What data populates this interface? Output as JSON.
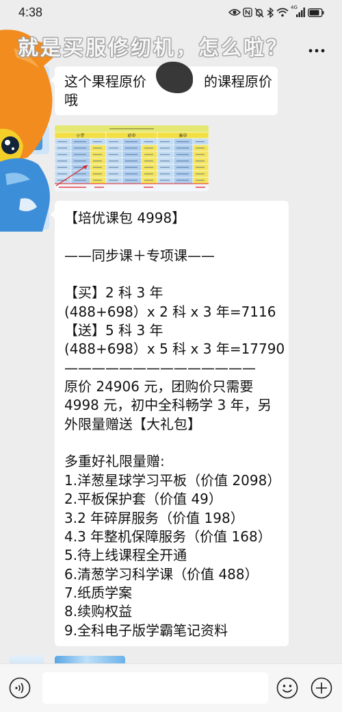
{
  "status_bar": {
    "time": "4:38",
    "network_type": "4G",
    "battery_level": 0.85,
    "icons": [
      "eye-icon",
      "nfc-icon",
      "mute-icon",
      "bluetooth-icon",
      "wifi-icon",
      "signal-icon",
      "battery-icon"
    ]
  },
  "header": {
    "overlay_title": "就是买服修纫机，怎么啦？",
    "icons": {
      "back": "back-arrow-icon",
      "more": "more-icon"
    }
  },
  "chat": {
    "text_message": {
      "line1_start": "这个果程原价",
      "line1_end": "的课程原价",
      "line2": "哦"
    },
    "price_table_image": {
      "headers": [
        "小学",
        "初中",
        "高中"
      ]
    },
    "promo_message": {
      "lines": [
        "【培优课包 4998】",
        "",
        "——同步课＋专项课——",
        "",
        "【买】2 科 3 年",
        "(488+698）x 2 科 x 3 年=7116",
        "【送】5 科 3 年",
        "(488+698）x 5 科 x 3 年=17790",
        "——————————————",
        "原价 24906 元，团购价只需要",
        "4998 元，初中全科畅学 3 年，另",
        "外限量赠送【大礼包】",
        "",
        "多重好礼限量赠:",
        "1.洋葱星球学习平板（价值 2098）",
        "2.平板保护套（价值 49）",
        "3.2 年碎屏服务（价值 198）",
        "4.3 年整机保障服务（价值 168）",
        "5.待上线课程全开通",
        "6.清葱学习科学课（价值 488）",
        "7.纸质学案",
        "8.续购权益",
        "9.全科电子版学霸笔记资料"
      ]
    }
  },
  "input_bar": {
    "icons": {
      "voice": "voice-icon",
      "emoji": "emoji-icon",
      "more": "plus-icon"
    }
  },
  "colors": {
    "chat_background": "#ededed",
    "bubble": "#ffffff",
    "table_yellow": "#f2df45",
    "table_blue": "#aecdee",
    "highlight_red": "#e02020",
    "mascot_orange": "#f28c1e",
    "mascot_blue": "#3d8ed8"
  }
}
